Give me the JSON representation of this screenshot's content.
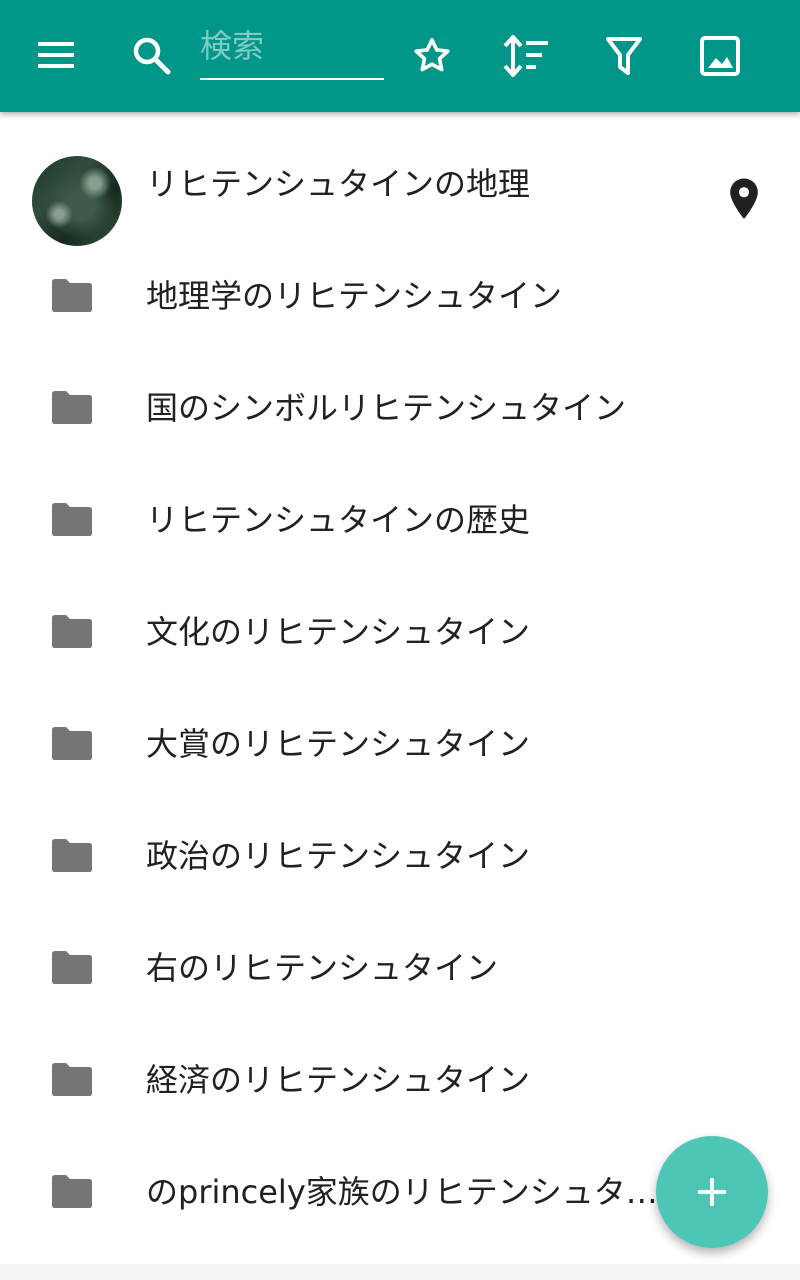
{
  "toolbar": {
    "background_color": "#009688",
    "search": {
      "placeholder": "検索",
      "value": ""
    },
    "icons": [
      "menu-icon",
      "search-icon",
      "star-outline-icon",
      "sort-icon",
      "filter-icon",
      "image-icon"
    ]
  },
  "category": {
    "title": "リヒテンシュタインの地理",
    "thumbnail": "satellite-map-thumbnail",
    "action_icon": "place-pin-icon"
  },
  "subcategories": [
    {
      "label": "地理学のリヒテンシュタイン",
      "icon": "folder-icon"
    },
    {
      "label": "国のシンボルリヒテンシュタイン",
      "icon": "folder-icon"
    },
    {
      "label": "リヒテンシュタインの歴史",
      "icon": "folder-icon"
    },
    {
      "label": "文化のリヒテンシュタイン",
      "icon": "folder-icon"
    },
    {
      "label": "大賞のリヒテンシュタイン",
      "icon": "folder-icon"
    },
    {
      "label": "政治のリヒテンシュタイン",
      "icon": "folder-icon"
    },
    {
      "label": "右のリヒテンシュタイン",
      "icon": "folder-icon"
    },
    {
      "label": "経済のリヒテンシュタイン",
      "icon": "folder-icon"
    },
    {
      "label": "のprincely家族のリヒテンシュタイン",
      "icon": "folder-icon"
    }
  ],
  "fab": {
    "icon": "plus-icon",
    "color": "#4ec6b6"
  }
}
